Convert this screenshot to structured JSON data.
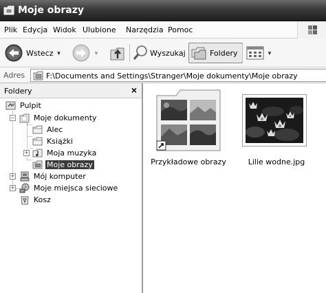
{
  "window": {
    "title": "Moje obrazy"
  },
  "menu": [
    "Plik",
    "Edycja",
    "Widok",
    "Ulubione",
    "Narzędzia",
    "Pomoc"
  ],
  "toolbar": {
    "back_label": "Wstecz",
    "search_label": "Wyszukaj",
    "folders_label": "Foldery"
  },
  "address": {
    "label": "Adres",
    "path": "F:\\Documents and Settings\\Stranger\\Moje dokumenty\\Moje obrazy"
  },
  "folders_pane": {
    "title": "Foldery",
    "close": "×"
  },
  "tree": [
    {
      "label": "Pulpit"
    },
    {
      "label": "Moje dokumenty"
    },
    {
      "label": "Alec"
    },
    {
      "label": "Książki"
    },
    {
      "label": "Moja muzyka"
    },
    {
      "label": "Moje obrazy",
      "selected": true
    },
    {
      "label": "Mój komputer"
    },
    {
      "label": "Moje miejsca sieciowe"
    },
    {
      "label": "Kosz"
    }
  ],
  "items": [
    {
      "label": "Przykładowe obrazy",
      "icon": "folder-with-thumbnails-icon"
    },
    {
      "label": "Lilie wodne.jpg",
      "icon": "image-thumbnail"
    }
  ]
}
